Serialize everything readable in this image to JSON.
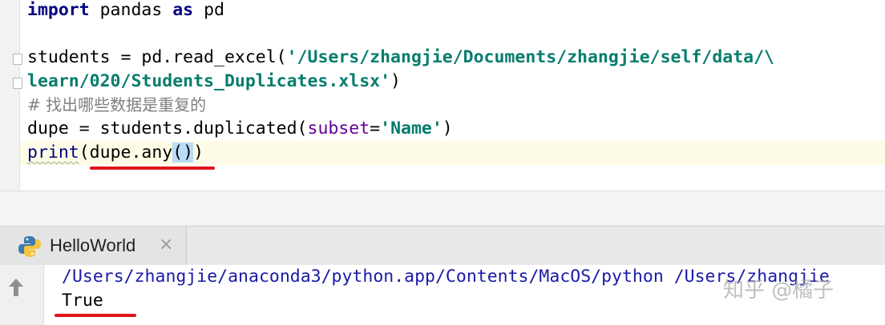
{
  "editor": {
    "lines": {
      "l0": {
        "kw": "import",
        "rest": " pandas ",
        "kw2": "as",
        "rest2": " pd"
      },
      "l2": {
        "a": "students = pd.read_excel(",
        "s": "'/Users/zhangjie/Documents/zhangjie/self/data/\\"
      },
      "l3": {
        "s": "learn/020/Students_Duplicates.xlsx'",
        "b": ")"
      },
      "l4": {
        "c": "# 找出哪些数据是重复的"
      },
      "l5": {
        "a": "dupe = students.duplicated(",
        "p": "subset",
        "eq": "=",
        "s": "'Name'",
        "b": ")"
      },
      "l6": {
        "fn": "print",
        "a": "(dupe.any",
        "paren": "()",
        "b": ")"
      }
    }
  },
  "run_panel": {
    "tab_title": "HelloWorld",
    "tab_close": "×",
    "console_lines": [
      "/Users/zhangjie/anaconda3/python.app/Contents/MacOS/python /Users/zhangjie",
      "True"
    ]
  },
  "watermark": "知乎 @橘子",
  "colors": {
    "annotation_red": "#e0151a",
    "string_teal": "#067d6d",
    "keyword_navy": "#000080"
  }
}
